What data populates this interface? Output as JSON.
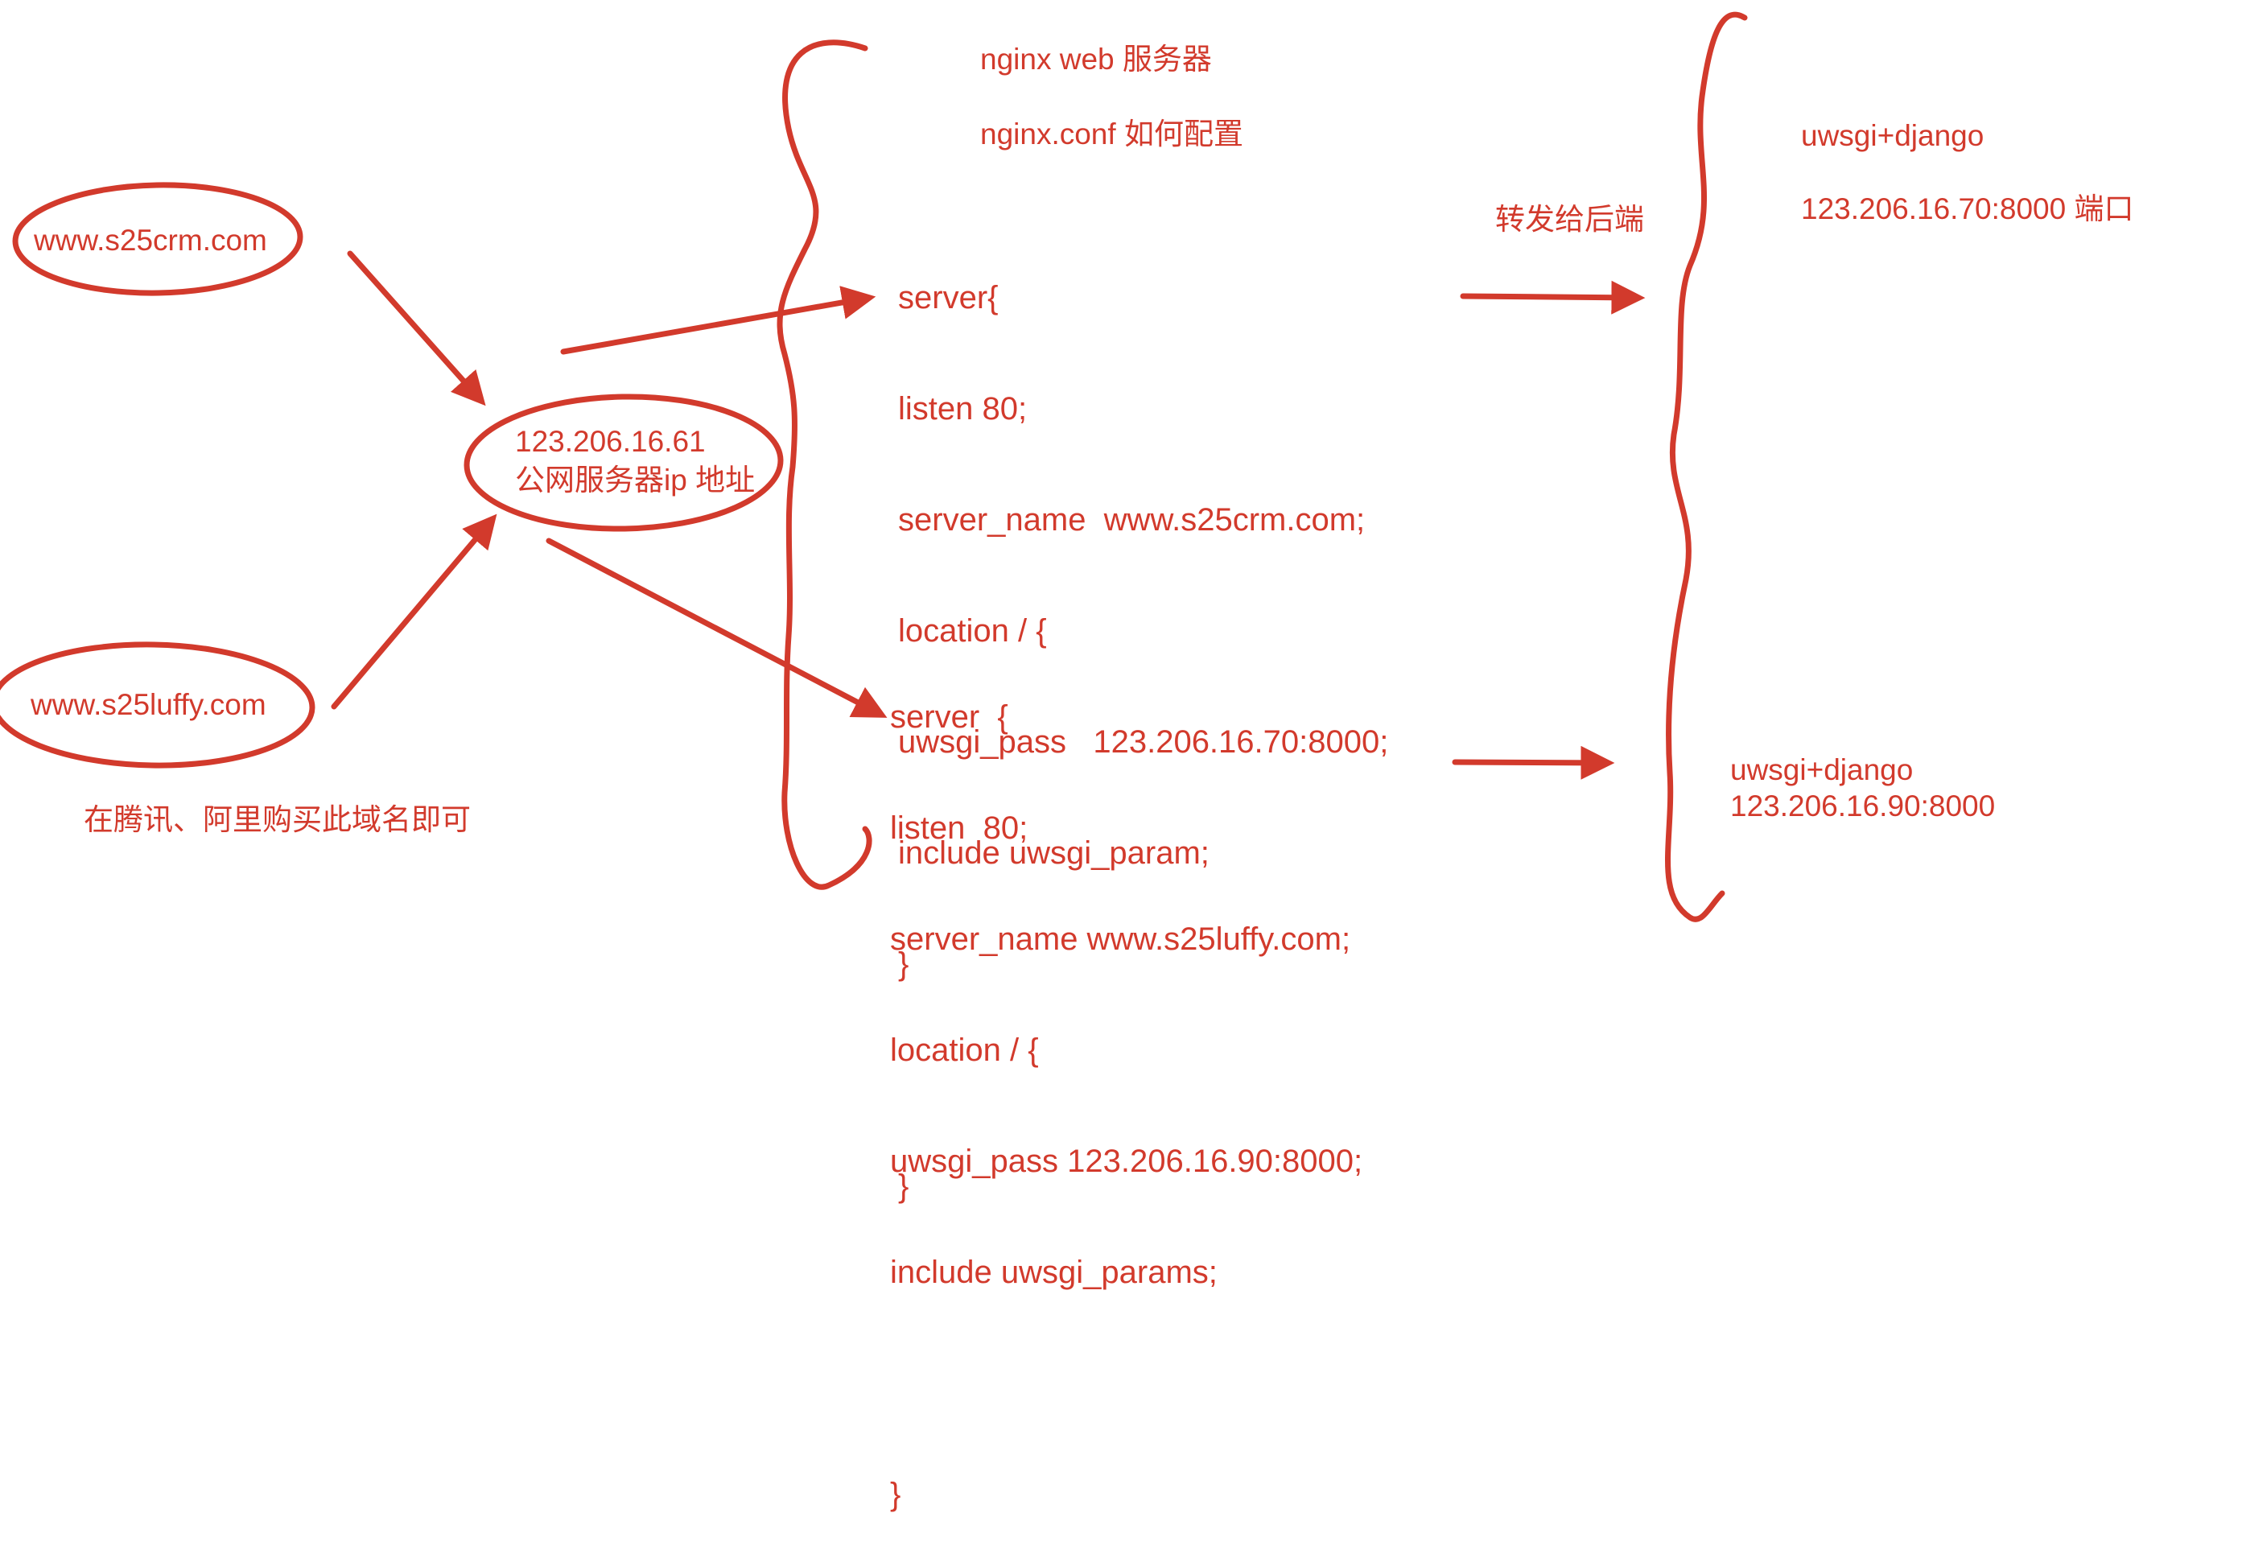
{
  "colors": {
    "ink": "#d23a2c",
    "background": "#ffffff"
  },
  "domains": {
    "crm": "www.s25crm.com",
    "luffy": "www.s25luffy.com"
  },
  "purchase_note": "在腾讯、阿里购买此域名即可",
  "public_server": {
    "ip": "123.206.16.61",
    "label": "公网服务器ip 地址"
  },
  "nginx": {
    "title": "nginx web 服务器",
    "config_question": "nginx.conf 如何配置"
  },
  "server_block_1": [
    "server{",
    "listen 80;",
    "server_name  www.s25crm.com;",
    "location / {",
    "uwsgi_pass   123.206.16.70:8000;",
    "include uwsgi_param;",
    "}",
    "",
    "}"
  ],
  "server_block_2": [
    "server  {",
    "listen  80;",
    "server_name www.s25luffy.com;",
    "location / {",
    "uwsgi_pass 123.206.16.90:8000;",
    "include uwsgi_params;",
    "",
    "}"
  ],
  "forward_label": "转发给后端",
  "backend_1": {
    "name": "uwsgi+django",
    "address": "123.206.16.70:8000 端口"
  },
  "backend_2": {
    "name": "uwsgi+django",
    "address": "123.206.16.90:8000"
  }
}
